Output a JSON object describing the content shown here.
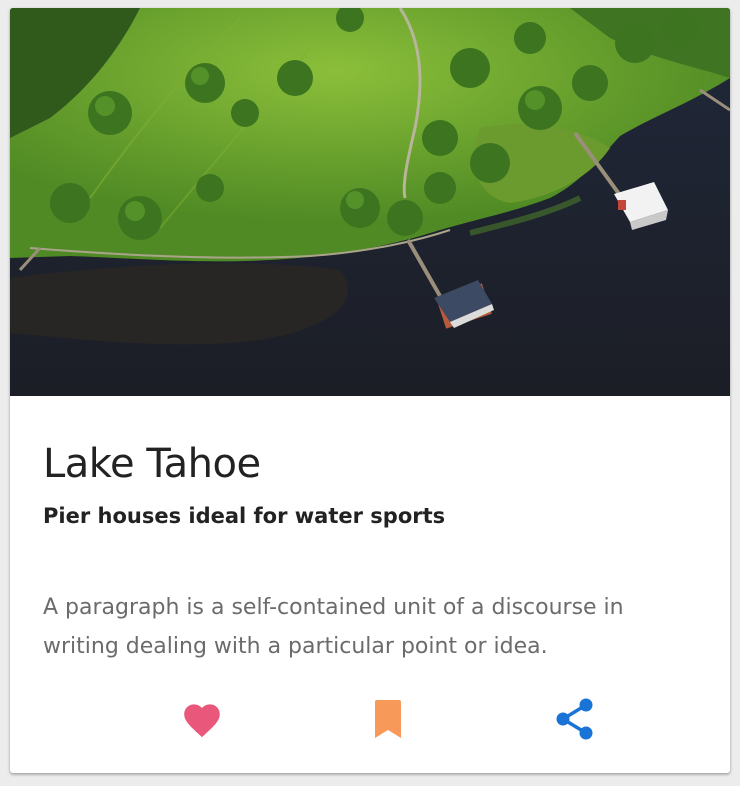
{
  "card": {
    "title": "Lake Tahoe",
    "subtitle": "Pier houses ideal for water sports",
    "description": "A paragraph is a self-contained unit of a discourse in writing dealing with a particular point or idea."
  },
  "actions": [
    {
      "icon": "heart-icon",
      "color": "#e9577a"
    },
    {
      "icon": "bookmark-icon",
      "color": "#f79a59"
    },
    {
      "icon": "share-icon",
      "color": "#1a73d6"
    }
  ]
}
